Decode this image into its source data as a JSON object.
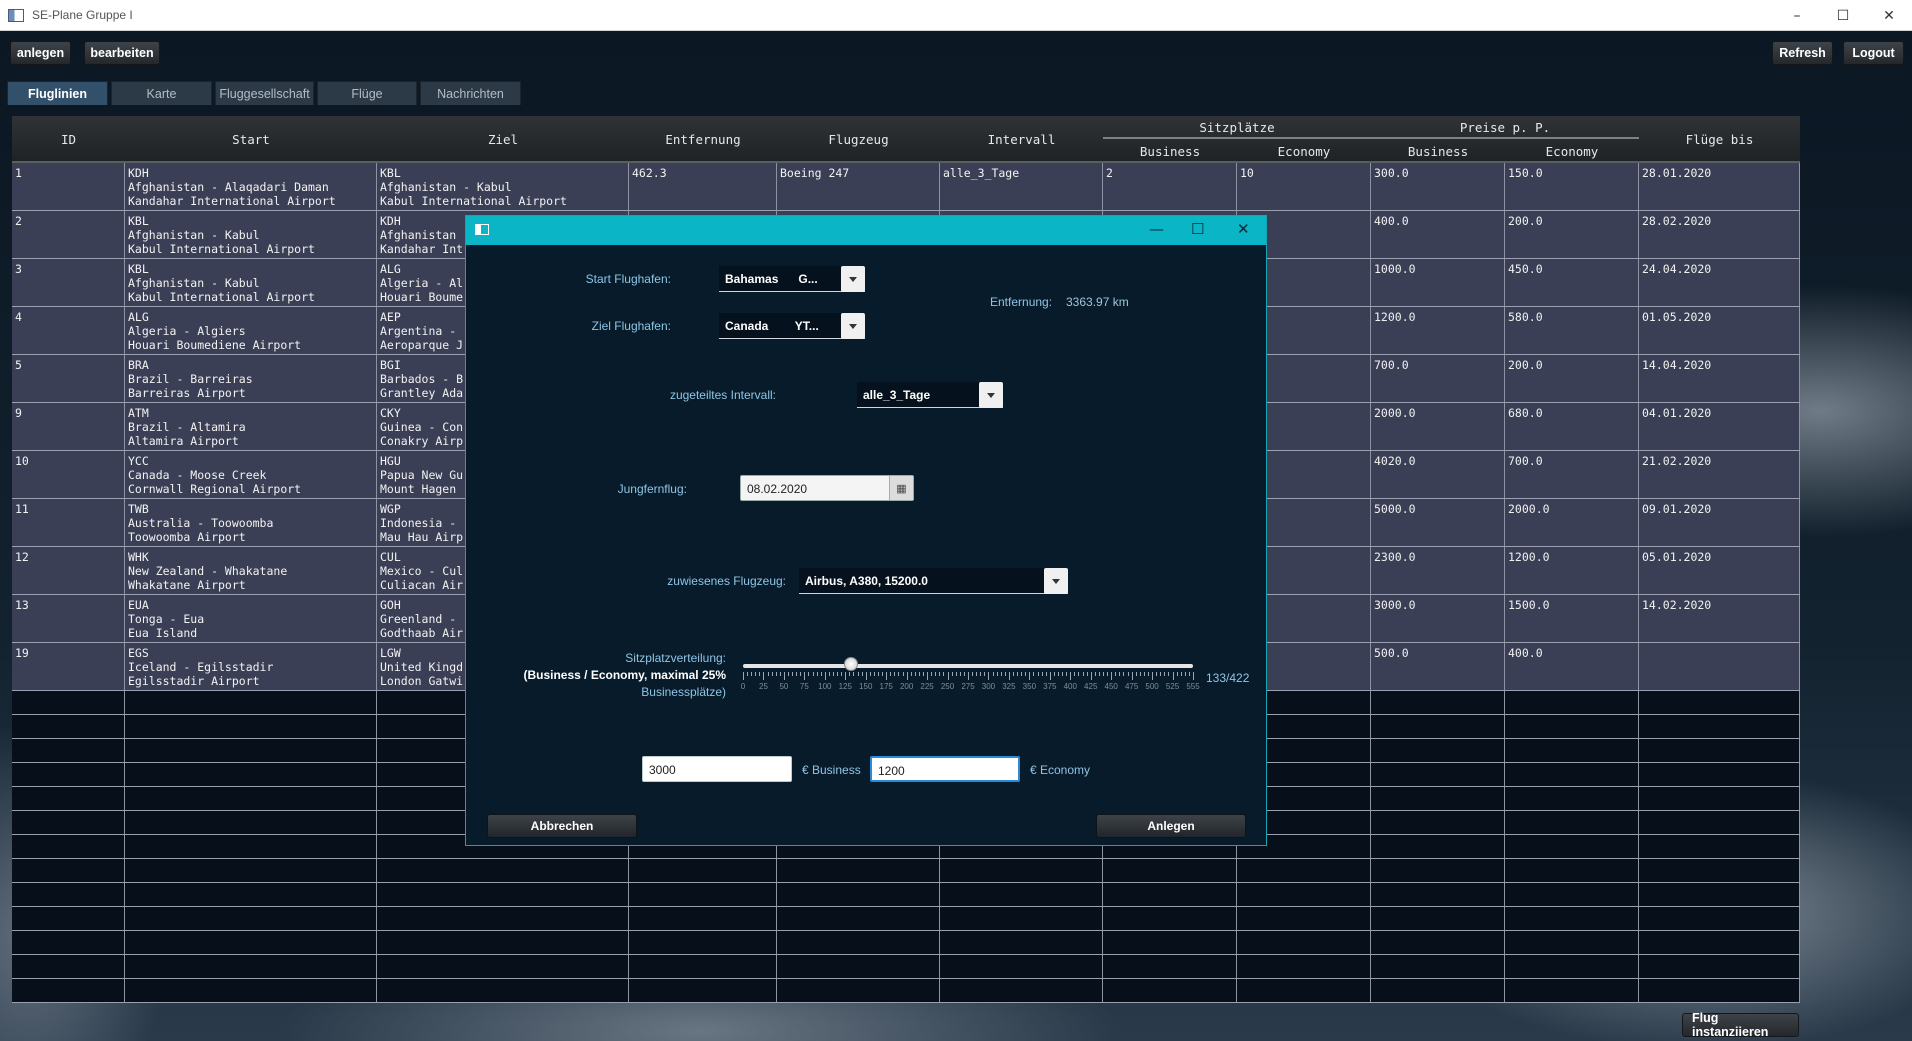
{
  "window": {
    "title": "SE-Plane Gruppe I",
    "controls": [
      "–",
      "☐",
      "✕"
    ]
  },
  "toolbar": {
    "create_label": "anlegen",
    "edit_label": "bearbeiten",
    "refresh_label": "Refresh",
    "logout_label": "Logout"
  },
  "tabs": [
    {
      "label": "Fluglinien",
      "active": true
    },
    {
      "label": "Karte"
    },
    {
      "label": "Fluggesellschaft"
    },
    {
      "label": "Flüge"
    },
    {
      "label": "Nachrichten"
    }
  ],
  "table": {
    "headers": {
      "id": "ID",
      "start": "Start",
      "ziel": "Ziel",
      "entfernung": "Entfernung",
      "flugzeug": "Flugzeug",
      "intervall": "Intervall",
      "sitzplaetze": "Sitzplätze",
      "preise": "Preise p. P.",
      "business": "Business",
      "economy": "Economy",
      "fluege_bis": "Flüge bis"
    },
    "rows": [
      {
        "id": "1",
        "start": "KDH\nAfghanistan - Alaqadari Daman\nKandahar International Airport",
        "ziel": "KBL\nAfghanistan - Kabul\nKabul International Airport",
        "entfernung": "462.3",
        "flugzeug": "Boeing 247",
        "intervall": "alle_3_Tage",
        "seat_business": "2",
        "seat_economy": "10",
        "price_business": "300.0",
        "price_economy": "150.0",
        "bis": "28.01.2020"
      },
      {
        "id": "2",
        "start": "KBL\nAfghanistan - Kabul\nKabul International Airport",
        "ziel": "KDH\nAfghanistan\nKandahar Int",
        "entfernung": "",
        "flugzeug": "",
        "intervall": "",
        "seat_business": "",
        "seat_economy": "",
        "price_business": "400.0",
        "price_economy": "200.0",
        "bis": "28.02.2020"
      },
      {
        "id": "3",
        "start": "KBL\nAfghanistan - Kabul\nKabul International Airport",
        "ziel": "ALG\nAlgeria - Al\nHouari Boume",
        "entfernung": "",
        "flugzeug": "",
        "intervall": "",
        "seat_business": "",
        "seat_economy": "",
        "price_business": "1000.0",
        "price_economy": "450.0",
        "bis": "24.04.2020"
      },
      {
        "id": "4",
        "start": "ALG\nAlgeria - Algiers\nHouari Boumediene Airport",
        "ziel": "AEP\nArgentina -\nAeroparque J",
        "entfernung": "",
        "flugzeug": "",
        "intervall": "",
        "seat_business": "",
        "seat_economy": "",
        "price_business": "1200.0",
        "price_economy": "580.0",
        "bis": "01.05.2020"
      },
      {
        "id": "5",
        "start": "BRA\nBrazil - Barreiras\nBarreiras Airport",
        "ziel": "BGI\nBarbados - B\nGrantley Ada",
        "entfernung": "",
        "flugzeug": "",
        "intervall": "",
        "seat_business": "",
        "seat_economy": "",
        "price_business": "700.0",
        "price_economy": "200.0",
        "bis": "14.04.2020"
      },
      {
        "id": "9",
        "start": "ATM\nBrazil - Altamira\nAltamira Airport",
        "ziel": "CKY\nGuinea - Con\nConakry Airp",
        "entfernung": "",
        "flugzeug": "",
        "intervall": "",
        "seat_business": "",
        "seat_economy": "",
        "price_business": "2000.0",
        "price_economy": "680.0",
        "bis": "04.01.2020"
      },
      {
        "id": "10",
        "start": "YCC\nCanada - Moose Creek\nCornwall Regional Airport",
        "ziel": "HGU\nPapua New Gu\nMount Hagen",
        "entfernung": "",
        "flugzeug": "",
        "intervall": "",
        "seat_business": "",
        "seat_economy": "",
        "price_business": "4020.0",
        "price_economy": "700.0",
        "bis": "21.02.2020"
      },
      {
        "id": "11",
        "start": "TWB\nAustralia - Toowoomba\nToowoomba Airport",
        "ziel": "WGP\nIndonesia -\nMau Hau Airp",
        "entfernung": "",
        "flugzeug": "",
        "intervall": "",
        "seat_business": "",
        "seat_economy": "",
        "price_business": "5000.0",
        "price_economy": "2000.0",
        "bis": "09.01.2020"
      },
      {
        "id": "12",
        "start": "WHK\nNew Zealand - Whakatane\nWhakatane Airport",
        "ziel": "CUL\nMexico - Cul\nCuliacan Air",
        "entfernung": "",
        "flugzeug": "",
        "intervall": "",
        "seat_business": "",
        "seat_economy": "",
        "price_business": "2300.0",
        "price_economy": "1200.0",
        "bis": "05.01.2020"
      },
      {
        "id": "13",
        "start": "EUA\nTonga - Eua\nEua Island",
        "ziel": "GOH\nGreenland -\nGodthaab Air",
        "entfernung": "",
        "flugzeug": "",
        "intervall": "",
        "seat_business": "",
        "seat_economy": "",
        "price_business": "3000.0",
        "price_economy": "1500.0",
        "bis": "14.02.2020"
      },
      {
        "id": "19",
        "start": "EGS\nIceland - Egilsstadir\nEgilsstadir Airport",
        "ziel": "LGW\nUnited Kingd\nLondon Gatwi",
        "entfernung": "",
        "flugzeug": "",
        "intervall": "",
        "seat_business": "",
        "seat_economy": "",
        "price_business": "500.0",
        "price_economy": "400.0",
        "bis": ""
      }
    ],
    "empty_rows": 13
  },
  "footer": {
    "instantiate_label": "Flug instanziieren"
  },
  "dialog": {
    "start_label": "Start Flughafen:",
    "start_value": "Bahamas      G...",
    "ziel_label": "Ziel Flughafen:",
    "ziel_value": "Canada        YT...",
    "distance_label": "Entfernung:",
    "distance_value": "3363.97 km",
    "interval_label": "zugeteiltes Intervall:",
    "interval_value": "alle_3_Tage",
    "maiden_label": "Jungfernflug:",
    "maiden_value": "08.02.2020",
    "plane_label": "zuwiesenes Flugzeug:",
    "plane_value": "Airbus, A380, 15200.0",
    "seat_label_1": "Sitzplatzverteilung:",
    "seat_label_2": "(Business / Economy, maximal 25%",
    "seat_label_3": "Businessplätze)",
    "seat_value": "133/422",
    "slider_fraction": 0.24,
    "tick_labels": [
      "0",
      "25",
      "50",
      "75",
      "100",
      "125",
      "150",
      "175",
      "200",
      "225",
      "250",
      "275",
      "300",
      "325",
      "350",
      "375",
      "400",
      "425",
      "450",
      "475",
      "500",
      "525",
      "555"
    ],
    "business_price": "3000",
    "business_suffix": "€ Business",
    "economy_price": "1200",
    "economy_suffix": "€ Economy",
    "cancel_label": "Abbrechen",
    "create_label": "Anlegen",
    "controls": [
      "—",
      "☐",
      "✕"
    ]
  },
  "colors": {
    "accent": "#0ab5c5",
    "row_bg": "#3a3f55",
    "label": "#8ec5e6"
  }
}
